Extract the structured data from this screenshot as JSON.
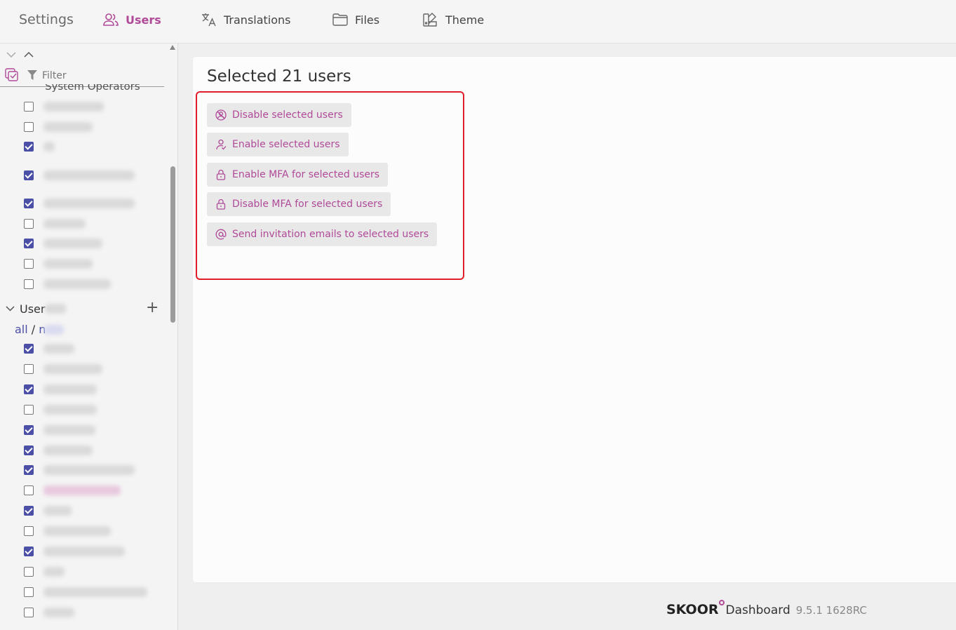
{
  "nav": {
    "title": "Settings",
    "tabs": [
      {
        "label": "Users",
        "icon": "users-icon",
        "active": true
      },
      {
        "label": "Translations",
        "icon": "translate-icon",
        "active": false
      },
      {
        "label": "Files",
        "icon": "folder-icon",
        "active": false
      },
      {
        "label": "Theme",
        "icon": "theme-icon",
        "active": false
      }
    ]
  },
  "sidebar": {
    "filter_placeholder": "Filter",
    "cut_label": "System Operators",
    "group_label": "User",
    "all_link": "all",
    "all_sep": " / ",
    "all_next": "n",
    "group_checks": [
      false,
      false,
      true,
      true,
      true,
      false,
      true,
      false,
      false
    ],
    "user_checks": [
      true,
      false,
      true,
      false,
      true,
      true,
      true,
      false,
      true,
      false,
      true,
      false,
      false,
      false
    ]
  },
  "main": {
    "title": "Selected 21 users",
    "actions": [
      {
        "label": "Disable selected users",
        "icon": "user-disable-icon"
      },
      {
        "label": "Enable selected users",
        "icon": "user-enable-icon"
      },
      {
        "label": "Enable MFA for selected users",
        "icon": "lock-open-icon"
      },
      {
        "label": "Disable MFA for selected users",
        "icon": "lock-icon"
      },
      {
        "label": "Send invitation emails to selected users",
        "icon": "at-icon"
      }
    ]
  },
  "footer": {
    "brand": "SKOOR",
    "product": "Dashboard",
    "version": "9.5.1 1628RC"
  },
  "colors": {
    "accent": "#b04a98",
    "checkbox": "#4b4fa6",
    "highlight": "#e01e2a"
  }
}
